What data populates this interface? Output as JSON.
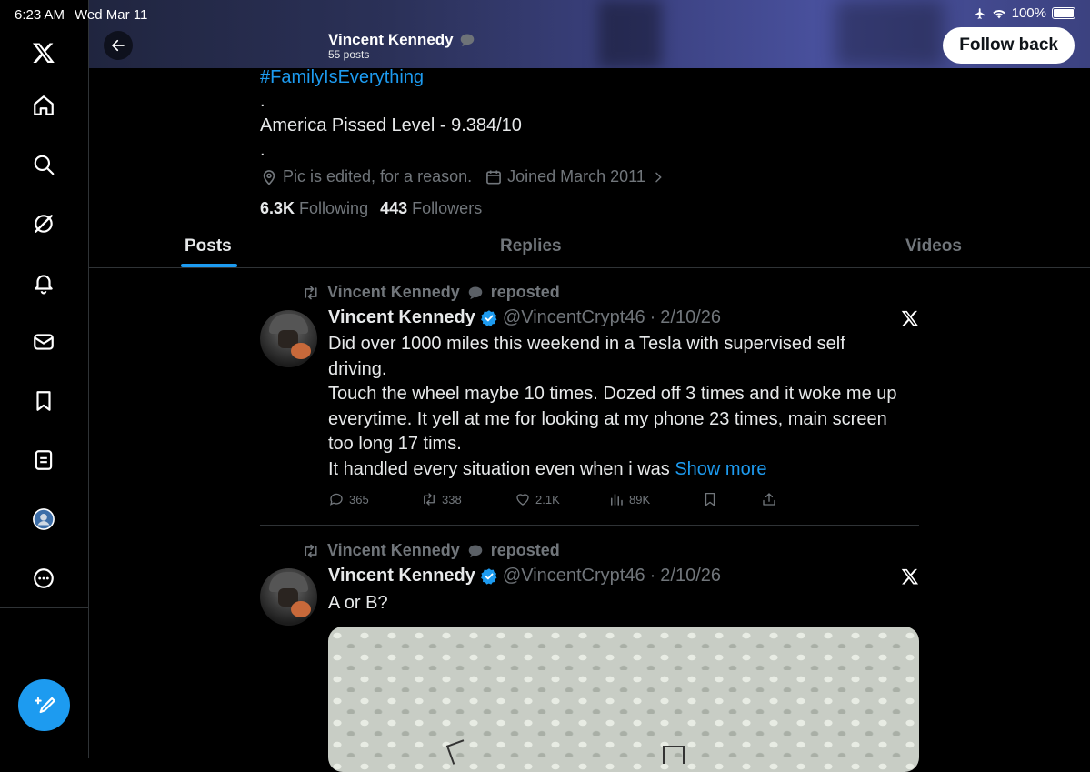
{
  "status_bar": {
    "time": "6:23 AM",
    "date": "Wed Mar 11",
    "battery": "100%"
  },
  "header": {
    "name": "Vincent Kennedy",
    "posts_count": "55 posts",
    "follow_label": "Follow back"
  },
  "profile": {
    "hashtag": "#FamilyIsEverything",
    "dot": ".",
    "bio_line": "America Pissed Level - 9.384/10",
    "location": "Pic is edited, for a reason.",
    "joined": "Joined March 2011",
    "following_count": "6.3K",
    "following_label": "Following",
    "followers_count": "443",
    "followers_label": "Followers"
  },
  "tabs": [
    {
      "label": "Posts"
    },
    {
      "label": "Replies"
    },
    {
      "label": "Videos"
    }
  ],
  "posts": [
    {
      "repost_by": "Vincent Kennedy",
      "repost_label": "reposted",
      "name": "Vincent Kennedy",
      "handle": "@VincentCrypt46",
      "sep": "·",
      "date": "2/10/26",
      "lines": [
        "Did over 1000 miles this weekend in a Tesla with supervised self",
        "driving.",
        "Touch the wheel maybe 10 times. Dozed off 3 times and it woke me up",
        "everytime. It yell at me for looking at my phone 23 times, main screen",
        "too long 17 tims.",
        "It handled every situation even when i was"
      ],
      "show_more": "Show more",
      "replies": "365",
      "reposts": "338",
      "likes": "2.1K",
      "views": "89K"
    },
    {
      "repost_by": "Vincent Kennedy",
      "repost_label": "reposted",
      "name": "Vincent Kennedy",
      "handle": "@VincentCrypt46",
      "sep": "·",
      "date": "2/10/26",
      "text": "A or B?"
    }
  ],
  "colors": {
    "accent": "#1d9bf0",
    "background": "#000000",
    "muted": "#71767b",
    "text": "#e7e9ea",
    "divider": "#2f3336"
  }
}
